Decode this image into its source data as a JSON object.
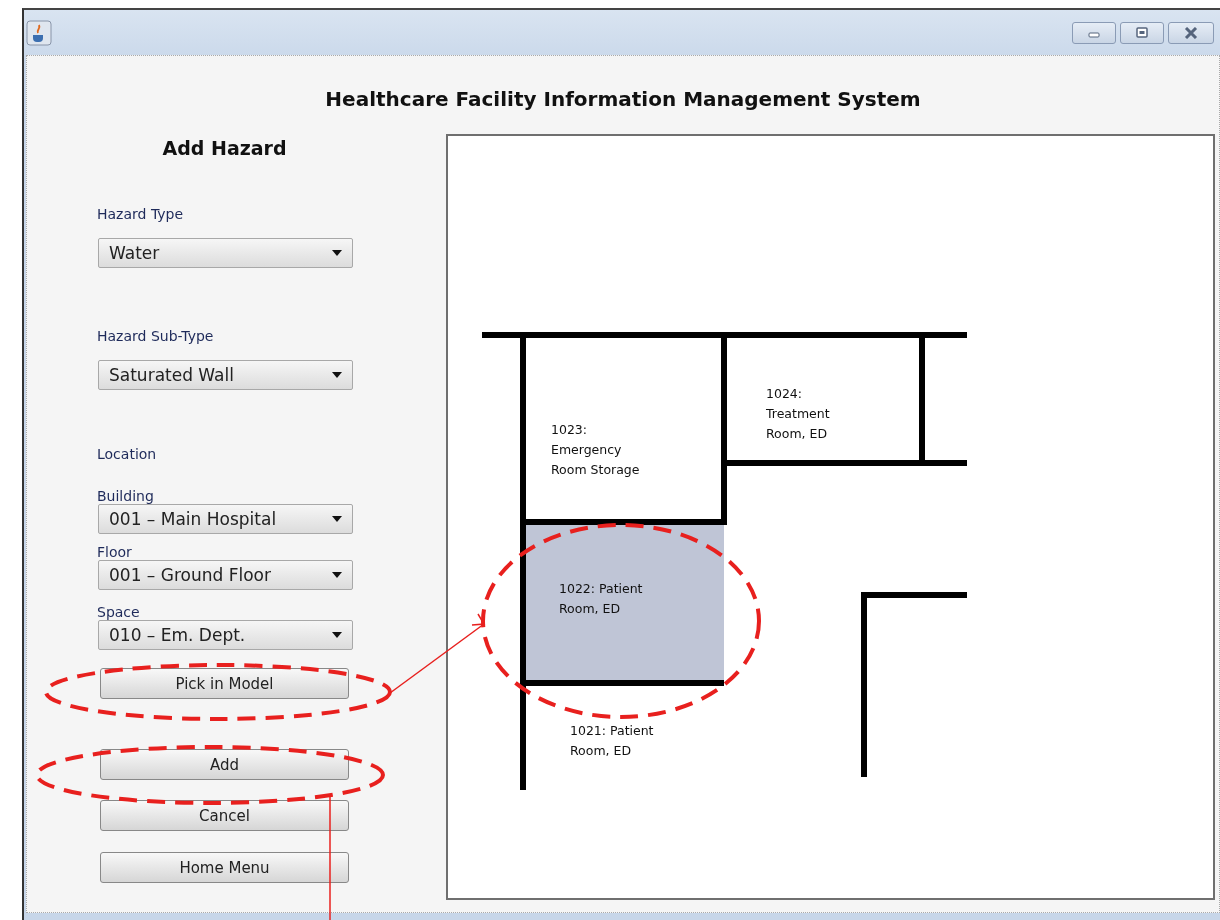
{
  "window": {
    "title": "Healthcare Facility Information Management System"
  },
  "form": {
    "heading": "Add Hazard",
    "fields": [
      {
        "kind": "dropdown",
        "label": "Hazard Type",
        "value": "Water"
      },
      {
        "kind": "dropdown",
        "label": "Hazard Sub-Type",
        "value": "Saturated Wall"
      },
      {
        "kind": "section",
        "label": "Location"
      },
      {
        "kind": "dropdown",
        "label": "Building",
        "value": "001 – Main Hospital"
      },
      {
        "kind": "dropdown",
        "label": "Floor",
        "value": "001 – Ground Floor"
      },
      {
        "kind": "dropdown",
        "label": "Space",
        "value": "010 – Em. Dept."
      }
    ],
    "buttons": [
      {
        "label": "Pick in Model"
      },
      {
        "label": "Add"
      },
      {
        "label": "Cancel"
      },
      {
        "label": "Home Menu"
      }
    ]
  },
  "annotations": [
    {
      "kind": "ellipse"
    },
    {
      "kind": "ellipse"
    },
    {
      "kind": "arrow"
    },
    {
      "kind": "ellipse"
    },
    {
      "kind": "leader_line"
    }
  ],
  "floor_plan": {
    "rooms": [
      {
        "lines": [
          "1023:",
          "Emergency",
          "Room Storage"
        ],
        "selected": false
      },
      {
        "lines": [
          "1024:",
          "Treatment",
          "Room, ED"
        ],
        "selected": false
      },
      {
        "lines": [
          "1022: Patient",
          "Room, ED"
        ],
        "selected": true
      },
      {
        "lines": [
          "1021: Patient",
          "Room, ED"
        ],
        "selected": false
      }
    ]
  }
}
